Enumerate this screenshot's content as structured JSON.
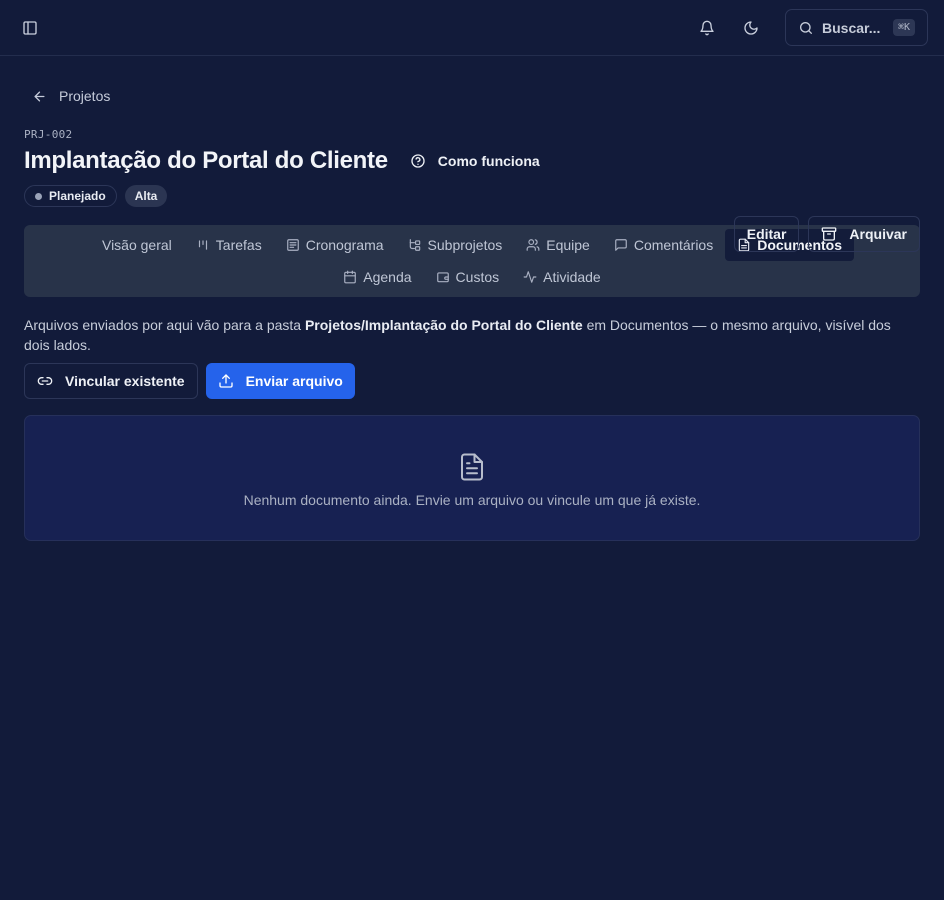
{
  "topbar": {
    "search_label": "Buscar...",
    "search_shortcut": "⌘K",
    "icons": [
      "sidebar-toggle-icon",
      "bell-icon",
      "moon-icon",
      "search-icon"
    ]
  },
  "breadcrumb": {
    "back_label": "Projetos"
  },
  "project": {
    "code": "PRJ-002",
    "title": "Implantação do Portal do Cliente",
    "how_label": "Como funciona",
    "status_badge": "Planejado",
    "priority_badge": "Alta"
  },
  "actions": {
    "edit_label": "Editar",
    "archive_label": "Arquivar"
  },
  "tabs": {
    "row1": [
      {
        "label": "Visão geral",
        "icon": "none"
      },
      {
        "label": "Tarefas",
        "icon": "kanban-icon"
      },
      {
        "label": "Cronograma",
        "icon": "list-icon"
      },
      {
        "label": "Subprojetos",
        "icon": "tree-icon"
      },
      {
        "label": "Equipe",
        "icon": "users-icon"
      },
      {
        "label": "Comentários",
        "icon": "message-icon"
      },
      {
        "label": "Documentos",
        "icon": "file-icon"
      }
    ],
    "row2": [
      {
        "label": "Agenda",
        "icon": "calendar-icon"
      },
      {
        "label": "Custos",
        "icon": "wallet-icon"
      },
      {
        "label": "Atividade",
        "icon": "activity-icon"
      }
    ],
    "active": "Documentos"
  },
  "documents": {
    "desc_before": "Arquivos enviados por aqui vão para a pasta ",
    "desc_path": "Projetos/Implantação do Portal do Cliente",
    "desc_after": " em Documentos — o mesmo arquivo, visível dos dois lados.",
    "link_label": "Vincular existente",
    "upload_label": "Enviar arquivo",
    "empty_message": "Nenhum documento ainda. Envie um arquivo ou vincule um que já existe."
  },
  "colors": {
    "background": "#121b3a",
    "primary": "#2563eb",
    "tabs_bg": "#283349",
    "empty_bg": "#172152"
  }
}
